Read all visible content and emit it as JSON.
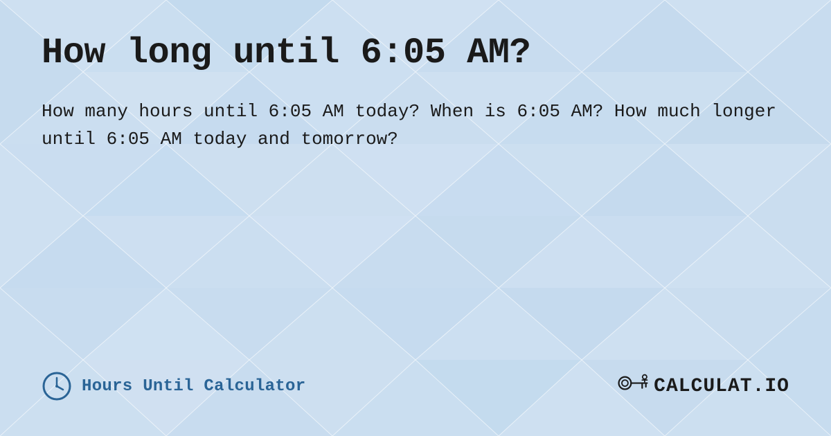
{
  "page": {
    "title": "How long until 6:05 AM?",
    "description": "How many hours until 6:05 AM today? When is 6:05 AM? How much longer until 6:05 AM today and tomorrow?",
    "footer": {
      "left_label": "Hours Until Calculator",
      "logo_text": "CALCULAT.IO"
    },
    "background_color": "#c8dff0",
    "accent_color": "#2a6496"
  }
}
